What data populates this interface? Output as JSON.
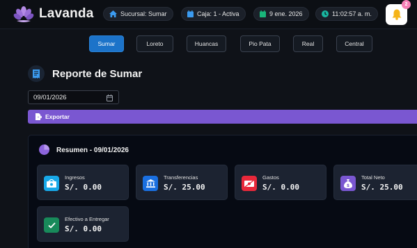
{
  "app": {
    "brand": "Lavanda"
  },
  "topbar": {
    "branch": "Sucursal: Sumar",
    "register": "Caja: 1 - Activa",
    "date": "9 ene. 2026",
    "time": "11:02:57 a. m.",
    "notifications_count": "2"
  },
  "tabs": [
    {
      "label": "Sumar",
      "active": true
    },
    {
      "label": "Loreto",
      "active": false
    },
    {
      "label": "Huancas",
      "active": false
    },
    {
      "label": "Pio Pata",
      "active": false
    },
    {
      "label": "Real",
      "active": false
    },
    {
      "label": "Central",
      "active": false
    }
  ],
  "report": {
    "title": "Reporte de Sumar",
    "date_value": "09/01/2026",
    "export_label": "Exportar"
  },
  "summary": {
    "title": "Resumen - 09/01/2026",
    "cards": [
      {
        "label": "Ingresos",
        "value": "S/. 0.00",
        "icon": "cash-icon",
        "color": "#18a8e8"
      },
      {
        "label": "Transferencias",
        "value": "S/. 25.00",
        "icon": "bank-icon",
        "color": "#1a6fe0"
      },
      {
        "label": "Gastos",
        "value": "S/. 0.00",
        "icon": "expense-icon",
        "color": "#e8283a"
      },
      {
        "label": "Total Neto",
        "value": "S/. 25.00",
        "icon": "money-bag-icon",
        "color": "#7a57d1"
      },
      {
        "label": "Efectivo a Entregar",
        "value": "S/. 0.00",
        "icon": "check-icon",
        "color": "#188a5a"
      }
    ]
  },
  "colors": {
    "accent_blue": "#1c73c9",
    "accent_purple": "#7a57d1",
    "background": "#0f1218"
  }
}
